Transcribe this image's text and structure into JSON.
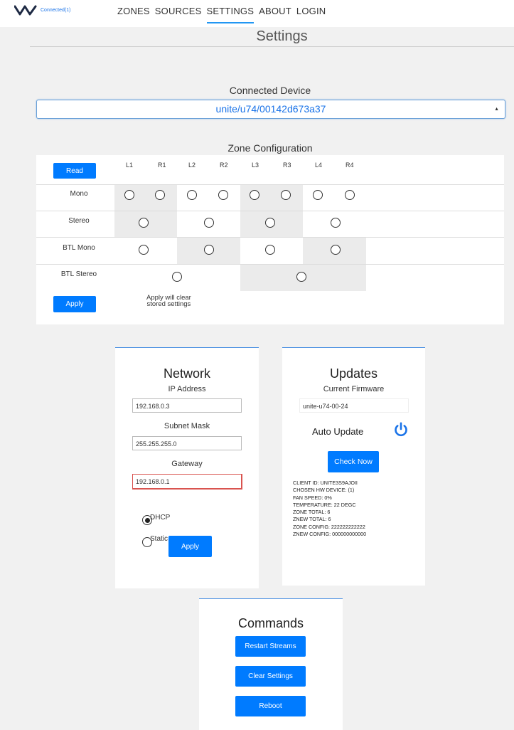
{
  "header": {
    "status": "Connected(1)",
    "nav": [
      "ZONES",
      "SOURCES",
      "SETTINGS",
      "ABOUT",
      "LOGIN"
    ],
    "active_nav": "SETTINGS"
  },
  "page": {
    "title": "Settings"
  },
  "connected_device": {
    "label": "Connected Device",
    "selected": "unite/u74/00142d673a37"
  },
  "zone_configuration": {
    "title": "Zone Configuration",
    "read_label": "Read",
    "columns": [
      "L1",
      "R1",
      "L2",
      "R2",
      "L3",
      "R3",
      "L4",
      "R4"
    ],
    "rows": [
      "Mono",
      "Stereo",
      "BTL Mono",
      "BTL Stereo"
    ],
    "apply_label": "Apply",
    "apply_note_line1": "Apply will clear",
    "apply_note_line2": "stored settings"
  },
  "network": {
    "title": "Network",
    "ip_label": "IP Address",
    "ip_value": "192.168.0.3",
    "mask_label": "Subnet Mask",
    "mask_value": "255.255.255.0",
    "gateway_label": "Gateway",
    "gateway_value": "192.168.0.1",
    "dhcp_label": "DHCP",
    "static_label": "Static",
    "dhcp_selected": true,
    "apply_label": "Apply"
  },
  "updates": {
    "title": "Updates",
    "firmware_label": "Current Firmware",
    "firmware_value": "unite-u74-00-24",
    "auto_update_label": "Auto Update",
    "auto_update_icon": "power-icon",
    "check_label": "Check Now",
    "info": [
      "CLIENT ID: unite3s9ajoii",
      "CHOSEN HW DEVICE: (1)",
      "FAN SPEED: 0%",
      "TEMPERATURE: 22 degC",
      "ZONE TOTAL: 6",
      "ZNEW TOTAL: 6",
      "ZONE CONFIG: 222222222222",
      "ZNEW CONFIG: 000000000000"
    ]
  },
  "commands": {
    "title": "Commands",
    "restart_label": "Restart Streams",
    "clear_label": "Clear Settings",
    "reboot_label": "Reboot"
  },
  "colors": {
    "accent": "#007bff",
    "link": "#1a73e8",
    "error": "#d9534f"
  }
}
